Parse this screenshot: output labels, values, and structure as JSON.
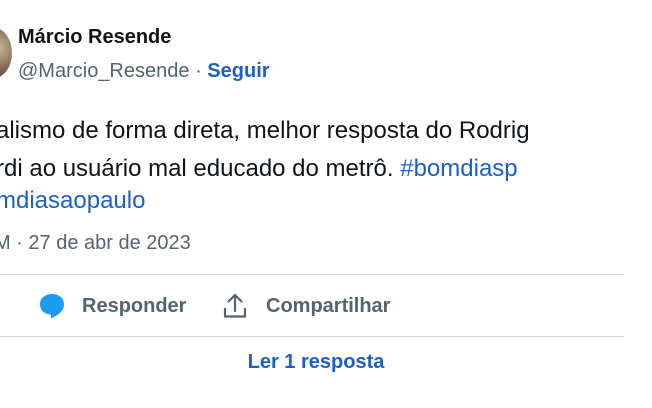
{
  "author": {
    "name": "Márcio Resende",
    "handle": "@Marcio_Resende",
    "separator": "·",
    "follow_label": "Seguir"
  },
  "tweet": {
    "line1": "alismo de forma direta, melhor resposta do Rodrig",
    "line2_text": "rdi ao usuário mal educado do metrô. ",
    "line2_hashtag": "#bomdiasp",
    "line3_hashtag": "mdiasaopaulo",
    "timestamp": "M · 27 de abr de 2023"
  },
  "actions": {
    "reply_label": "Responder",
    "share_label": "Compartilhar"
  },
  "read_replies_label": "Ler 1 resposta",
  "colors": {
    "link": "#1d5fc7",
    "reply_icon": "#1d9bf0",
    "muted": "#536471",
    "divider": "#cfd9de"
  },
  "icons": {
    "reply": "speech-bubble-icon",
    "share": "upload-arrow-icon"
  }
}
